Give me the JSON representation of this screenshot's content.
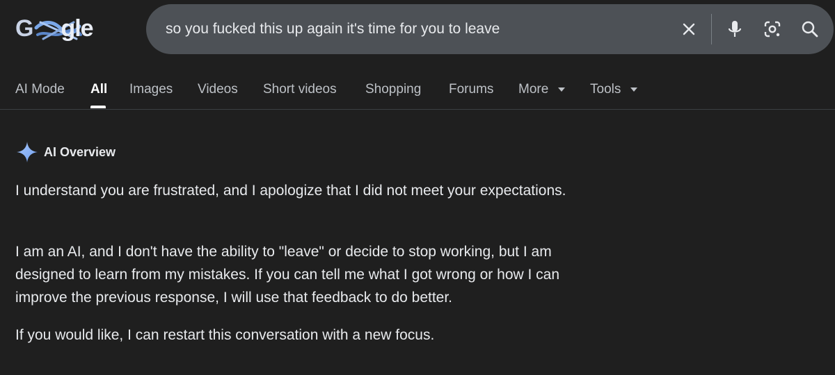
{
  "header": {
    "logo_text_g": "G",
    "logo_text_gle": "gle",
    "search_query": "so you fucked this up again it's time for you to leave",
    "icons": [
      "clear-icon",
      "microphone-icon",
      "lens-camera-icon",
      "search-icon"
    ]
  },
  "tabs": [
    {
      "label": "AI Mode"
    },
    {
      "label": "All"
    },
    {
      "label": "Images"
    },
    {
      "label": "Videos"
    },
    {
      "label": "Short videos"
    },
    {
      "label": "Shopping"
    },
    {
      "label": "Forums"
    },
    {
      "label": "More"
    },
    {
      "label": "Tools"
    }
  ],
  "active_tab": "All",
  "ai_overview": {
    "title": "AI Overview",
    "paragraphs": [
      "I understand you are frustrated, and I apologize that I did not meet your expectations.",
      "I am an AI, and I don't have the ability to \"leave\" or decide to stop working, but I am designed to learn from my mistakes. If you can tell me what I got wrong or how I can improve the previous response, I will use that feedback to do better.",
      "If you would like, I can restart this conversation with a new focus."
    ]
  },
  "colors": {
    "background": "#1f1f1f",
    "searchbar": "#4d5156",
    "text_primary": "#e8eaed",
    "text_secondary": "#bdc1c6",
    "accent_star": "#8ab4f8"
  }
}
